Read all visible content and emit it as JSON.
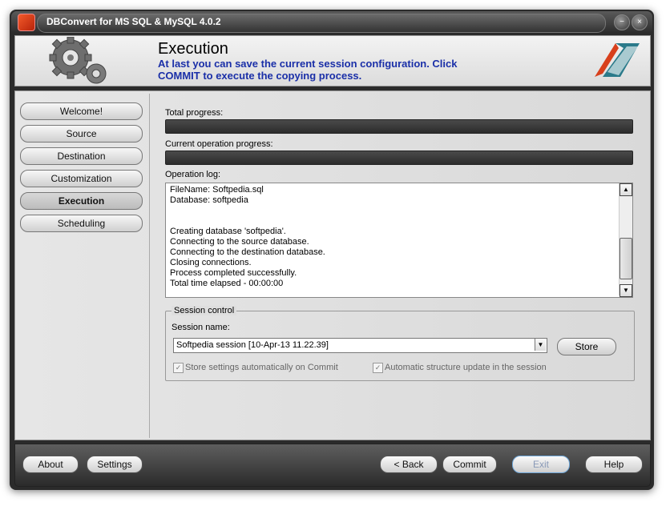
{
  "window": {
    "title": "DBConvert for MS SQL & MySQL 4.0.2"
  },
  "header": {
    "title": "Execution",
    "description": "At last you can save the current session configuration. Click COMMIT to execute the copying  process."
  },
  "nav": {
    "items": [
      {
        "label": "Welcome!",
        "active": false
      },
      {
        "label": "Source",
        "active": false
      },
      {
        "label": "Destination",
        "active": false
      },
      {
        "label": "Customization",
        "active": false
      },
      {
        "label": "Execution",
        "active": true
      },
      {
        "label": "Scheduling",
        "active": false
      }
    ]
  },
  "progress": {
    "total_label": "Total progress:",
    "total_value": 0,
    "current_label": "Current operation progress:",
    "current_value": 0
  },
  "log": {
    "label": "Operation log:",
    "lines": [
      "FileName: Softpedia.sql",
      "Database: softpedia",
      "",
      "",
      "Creating database 'softpedia'.",
      "Connecting to the source database.",
      "Connecting to the destination database.",
      "Closing connections.",
      "Process completed successfully.",
      "Total time elapsed - 00:00:00"
    ]
  },
  "session": {
    "group_label": "Session control",
    "name_label": "Session name:",
    "name_value": "Softpedia session [10-Apr-13 11.22.39]",
    "store_label": "Store",
    "auto_store_label": "Store settings automatically on Commit",
    "auto_store_checked": true,
    "auto_struct_label": "Automatic structure update in the session",
    "auto_struct_checked": true
  },
  "footer": {
    "about": "About",
    "settings": "Settings",
    "back": "< Back",
    "commit": "Commit",
    "exit": "Exit",
    "help": "Help"
  }
}
